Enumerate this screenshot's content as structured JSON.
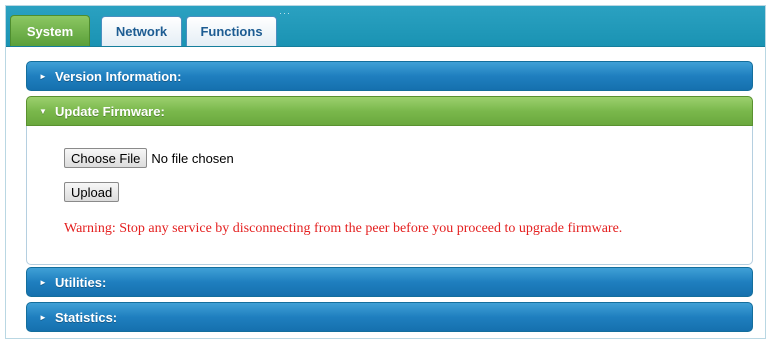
{
  "tabs": [
    {
      "label": "System",
      "active": true
    },
    {
      "label": "Network",
      "active": false
    },
    {
      "label": "Functions",
      "active": false
    }
  ],
  "sections": {
    "version": {
      "title": "Version Information:",
      "expanded": false
    },
    "update": {
      "title": "Update Firmware:",
      "expanded": true
    },
    "utilities": {
      "title": "Utilities:",
      "expanded": false
    },
    "statistics": {
      "title": "Statistics:",
      "expanded": false
    }
  },
  "firmware": {
    "choose_file_label": "Choose File",
    "file_status": "No file chosen",
    "upload_label": "Upload",
    "warning": "Warning: Stop any service by disconnecting from the peer before you proceed to upgrade firmware."
  },
  "icons": {
    "collapsed": "triangle-right-icon",
    "expanded": "triangle-down-icon"
  },
  "colors": {
    "tabbar": "#1a93b3",
    "header_blue": "#1f7fbf",
    "header_green": "#7ab84c",
    "warning": "#e41f1f"
  }
}
